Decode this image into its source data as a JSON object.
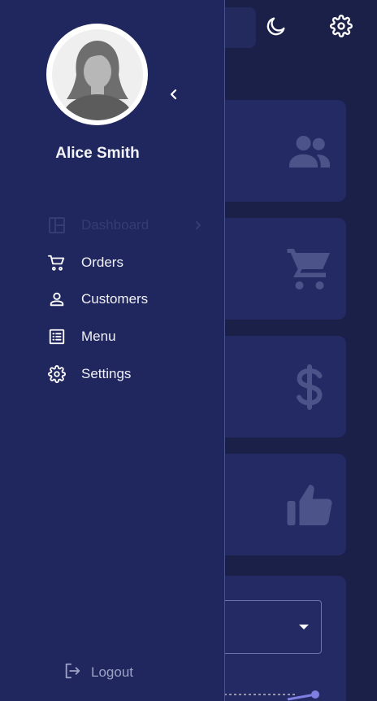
{
  "app": {
    "accent_color": "#7d80e0",
    "background_color": "#1b2049",
    "sidebar_color": "#20275f"
  },
  "topbar": {
    "theme_icon": "moon-icon",
    "settings_icon": "gear-icon"
  },
  "stat_cards": [
    {
      "icon": "users-icon"
    },
    {
      "icon": "cart-icon"
    },
    {
      "icon": "dollar-icon"
    },
    {
      "icon": "thumbs-up-icon"
    }
  ],
  "sidebar": {
    "user_name": "Alice Smith",
    "collapse_icon": "chevron-left-icon",
    "nav_items": [
      {
        "label": "Dashboard",
        "icon": "dashboard-icon",
        "disabled": true,
        "has_submenu": true
      },
      {
        "label": "Orders",
        "icon": "cart-icon"
      },
      {
        "label": "Customers",
        "icon": "person-icon"
      },
      {
        "label": "Menu",
        "icon": "list-icon"
      },
      {
        "label": "Settings",
        "icon": "gear-icon"
      }
    ],
    "logout_label": "Logout"
  }
}
